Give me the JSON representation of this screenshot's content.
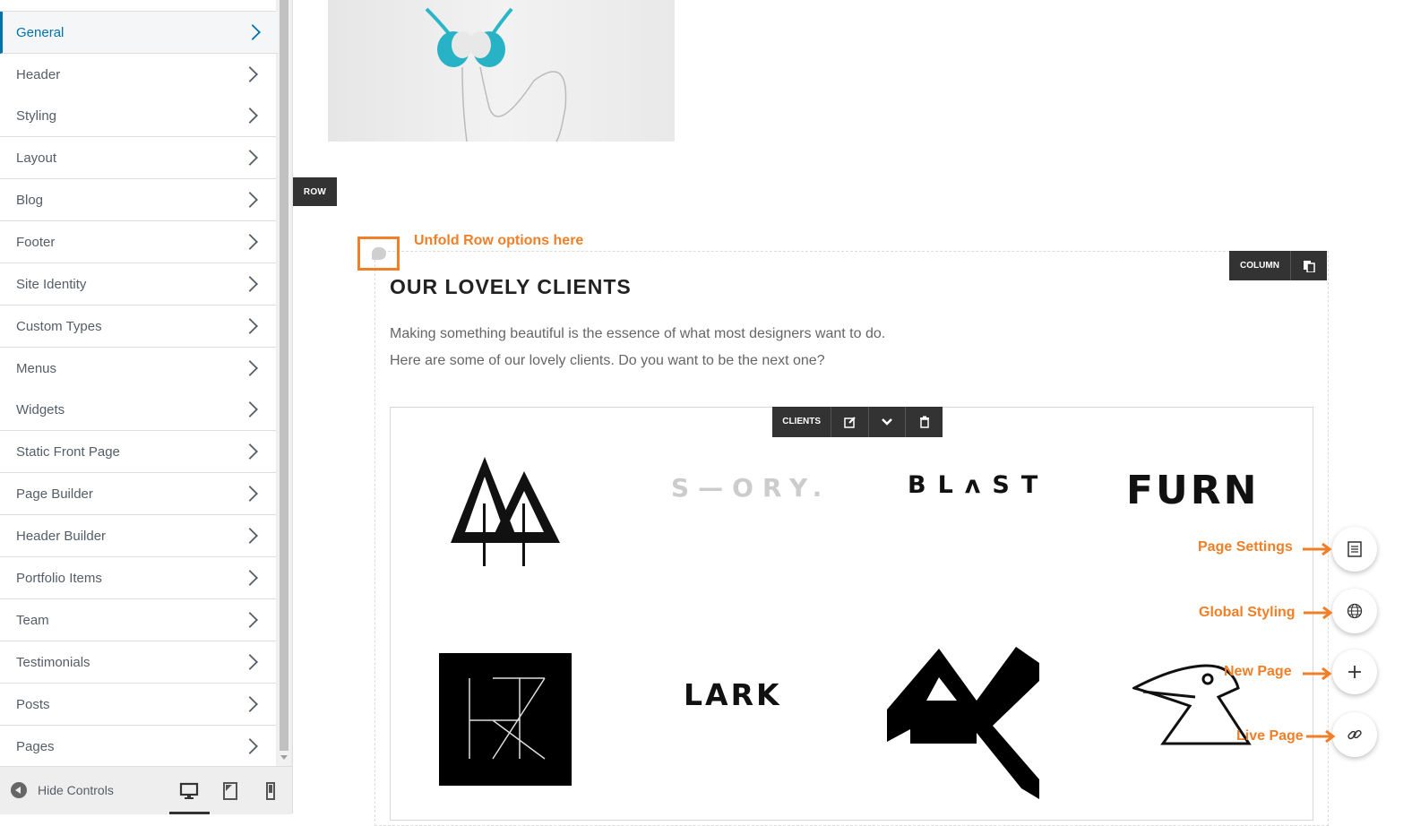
{
  "sidebar": {
    "items": [
      {
        "label": "General",
        "active": true
      },
      {
        "label": "Header"
      },
      {
        "label": "Styling"
      },
      {
        "label": "Layout"
      },
      {
        "label": "Blog"
      },
      {
        "label": "Footer"
      },
      {
        "label": "Site Identity"
      },
      {
        "label": "Custom Types"
      },
      {
        "label": "Menus"
      },
      {
        "label": "Widgets"
      },
      {
        "label": "Static Front Page"
      },
      {
        "label": "Page Builder"
      },
      {
        "label": "Header Builder"
      },
      {
        "label": "Portfolio Items"
      },
      {
        "label": "Team"
      },
      {
        "label": "Testimonials"
      },
      {
        "label": "Posts"
      },
      {
        "label": "Pages"
      }
    ],
    "hide_controls_label": "Hide Controls",
    "devices": [
      "desktop-icon",
      "tablet-icon",
      "mobile-icon"
    ],
    "active_device": "desktop"
  },
  "builder": {
    "row_label": "ROW",
    "column_label": "COLUMN",
    "clients_label": "CLIENTS",
    "unfold_annotation": "Unfold Row options here"
  },
  "content": {
    "title": "OUR LOVELY CLIENTS",
    "desc_line1": "Making something beautiful is the essence of what most designers want to do.",
    "desc_line2": "Here are some of our lovely clients. Do you want to be the next one?",
    "logos": {
      "story": "S—ORY.",
      "blast": "BLʌST",
      "furn": "FURN",
      "lark": "LARK"
    }
  },
  "fabs": {
    "page_settings": "Page Settings",
    "global_styling": "Global Styling",
    "new_page": "New Page",
    "live_page": "Live Page"
  },
  "colors": {
    "accent": "#f07f28",
    "active_menu": "#0073aa",
    "toolbar": "#333333"
  }
}
